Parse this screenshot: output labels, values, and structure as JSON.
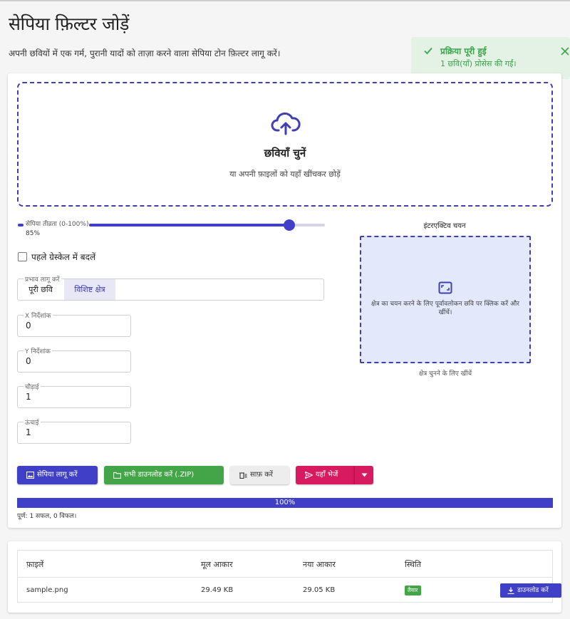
{
  "page": {
    "title": "सेपिया फ़िल्टर जोड़ें",
    "description": "अपनी छवियों में एक गर्म, पुरानी यादों को ताज़ा करने वाला सेपिया टोन फ़िल्टर लागू करें।"
  },
  "toast": {
    "title": "प्रक्रिया पूरी हुई",
    "message": "1 छवि(याँ) प्रोसेस की गईं।",
    "color": "#3aa54a"
  },
  "dropzone": {
    "title": "छवियाँ चुनें",
    "subtitle": "या अपनी फ़ाइलों को यहाँ खींचकर छोड़ें",
    "icon": "cloud-upload-icon"
  },
  "intensity": {
    "label": "सेपिया तीव्रता (0-100%)",
    "value_text": "85%",
    "value": 85
  },
  "grayscale": {
    "label": "पहले ग्रेस्केल में बदलें",
    "checked": false
  },
  "apply_to": {
    "label": "प्रभाव लागू करें",
    "options": [
      "पूरी छवि",
      "विशिष्ट क्षेत्र"
    ],
    "selected": "विशिष्ट क्षेत्र"
  },
  "fields": {
    "x": {
      "label": "X निर्देशांक",
      "value": "0"
    },
    "y": {
      "label": "Y निर्देशांक",
      "value": "0"
    },
    "width": {
      "label": "चौड़ाई",
      "value": "1"
    },
    "height": {
      "label": "ऊंचाई",
      "value": "1"
    }
  },
  "preview": {
    "title": "इंटरएक्टिव चयन",
    "text": "क्षेत्र का चयन करने के लिए पूर्वावलोकन छवि पर क्लिक करें और खींचें।",
    "caption": "क्षेत्र चुनने के लिए खींचें"
  },
  "actions": {
    "apply": "सेपिया लागू करें",
    "download_zip": "सभी डाउनलोड करें (.ZIP)",
    "clear": "साफ़ करें",
    "send": "यहाँ भेजें"
  },
  "progress": {
    "value": 100,
    "text": "100%",
    "summary": "पूर्ण: 1 सफल, 0 विफल।"
  },
  "table": {
    "headers": [
      "फ़ाइलें",
      "मूल आकार",
      "नया आकार",
      "स्थिति"
    ],
    "rows": [
      {
        "file": "sample.png",
        "original": "29.49 KB",
        "new": "29.05 KB",
        "status": "तैयार",
        "download": "डाउनलोड करें"
      }
    ]
  },
  "colors": {
    "primary": "#3f3fc8",
    "success": "#43a547",
    "send": "#d81b60"
  }
}
